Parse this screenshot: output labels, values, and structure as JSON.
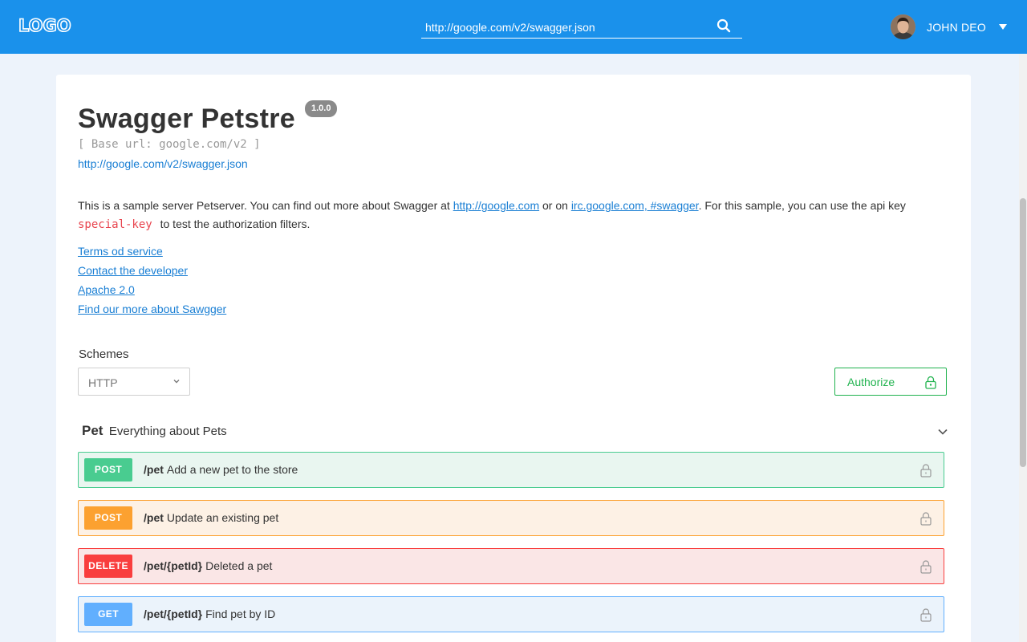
{
  "header": {
    "logo": "LOGO",
    "search_value": "http://google.com/v2/swagger.json",
    "user_name": "JOHN DEO",
    "bg_color": "#1a91eb"
  },
  "info": {
    "title": "Swagger Petstre",
    "version": "1.0.0",
    "base_url": "[ Base url: google.com/v2 ]",
    "spec_link": "http://google.com/v2/swagger.json",
    "description_1": "This is a sample server Petserver. You can find out more about Swagger at ",
    "description_link_1": "http://google.com",
    "description_2": " or on ",
    "description_link_2": "irc.google.com, #swagger",
    "description_3": ". For this sample, you can use the api key",
    "api_key": "special-key",
    "description_4": " to test the authorization filters.",
    "links": [
      "Terms od service",
      "Contact the developer",
      "Apache 2.0",
      "Find our more about Sawgger"
    ]
  },
  "schemes": {
    "label": "Schemes",
    "selected": "HTTP"
  },
  "authorize": {
    "label": "Authorize",
    "color": "#21b34f"
  },
  "section": {
    "name": "Pet",
    "description": "Everything about Pets"
  },
  "operations": [
    {
      "method": "POST",
      "path": "/pet",
      "summary": "Add a new pet to the store",
      "method_color": "#49cc90",
      "bg": "#e9f6f0",
      "border": "#49cc90"
    },
    {
      "method": "POST",
      "path": "/pet",
      "summary": "Update an existing pet",
      "method_color": "#fca130",
      "bg": "#fdf1e5",
      "border": "#fca130"
    },
    {
      "method": "DELETE",
      "path": "/pet/{petId}",
      "summary": "Deleted a pet",
      "method_color": "#f93e3e",
      "bg": "#fae6e6",
      "border": "#f93e3e"
    },
    {
      "method": "GET",
      "path": "/pet/{petId}",
      "summary": "Find pet by ID",
      "method_color": "#61affe",
      "bg": "#ebf3fb",
      "border": "#61affe"
    }
  ]
}
